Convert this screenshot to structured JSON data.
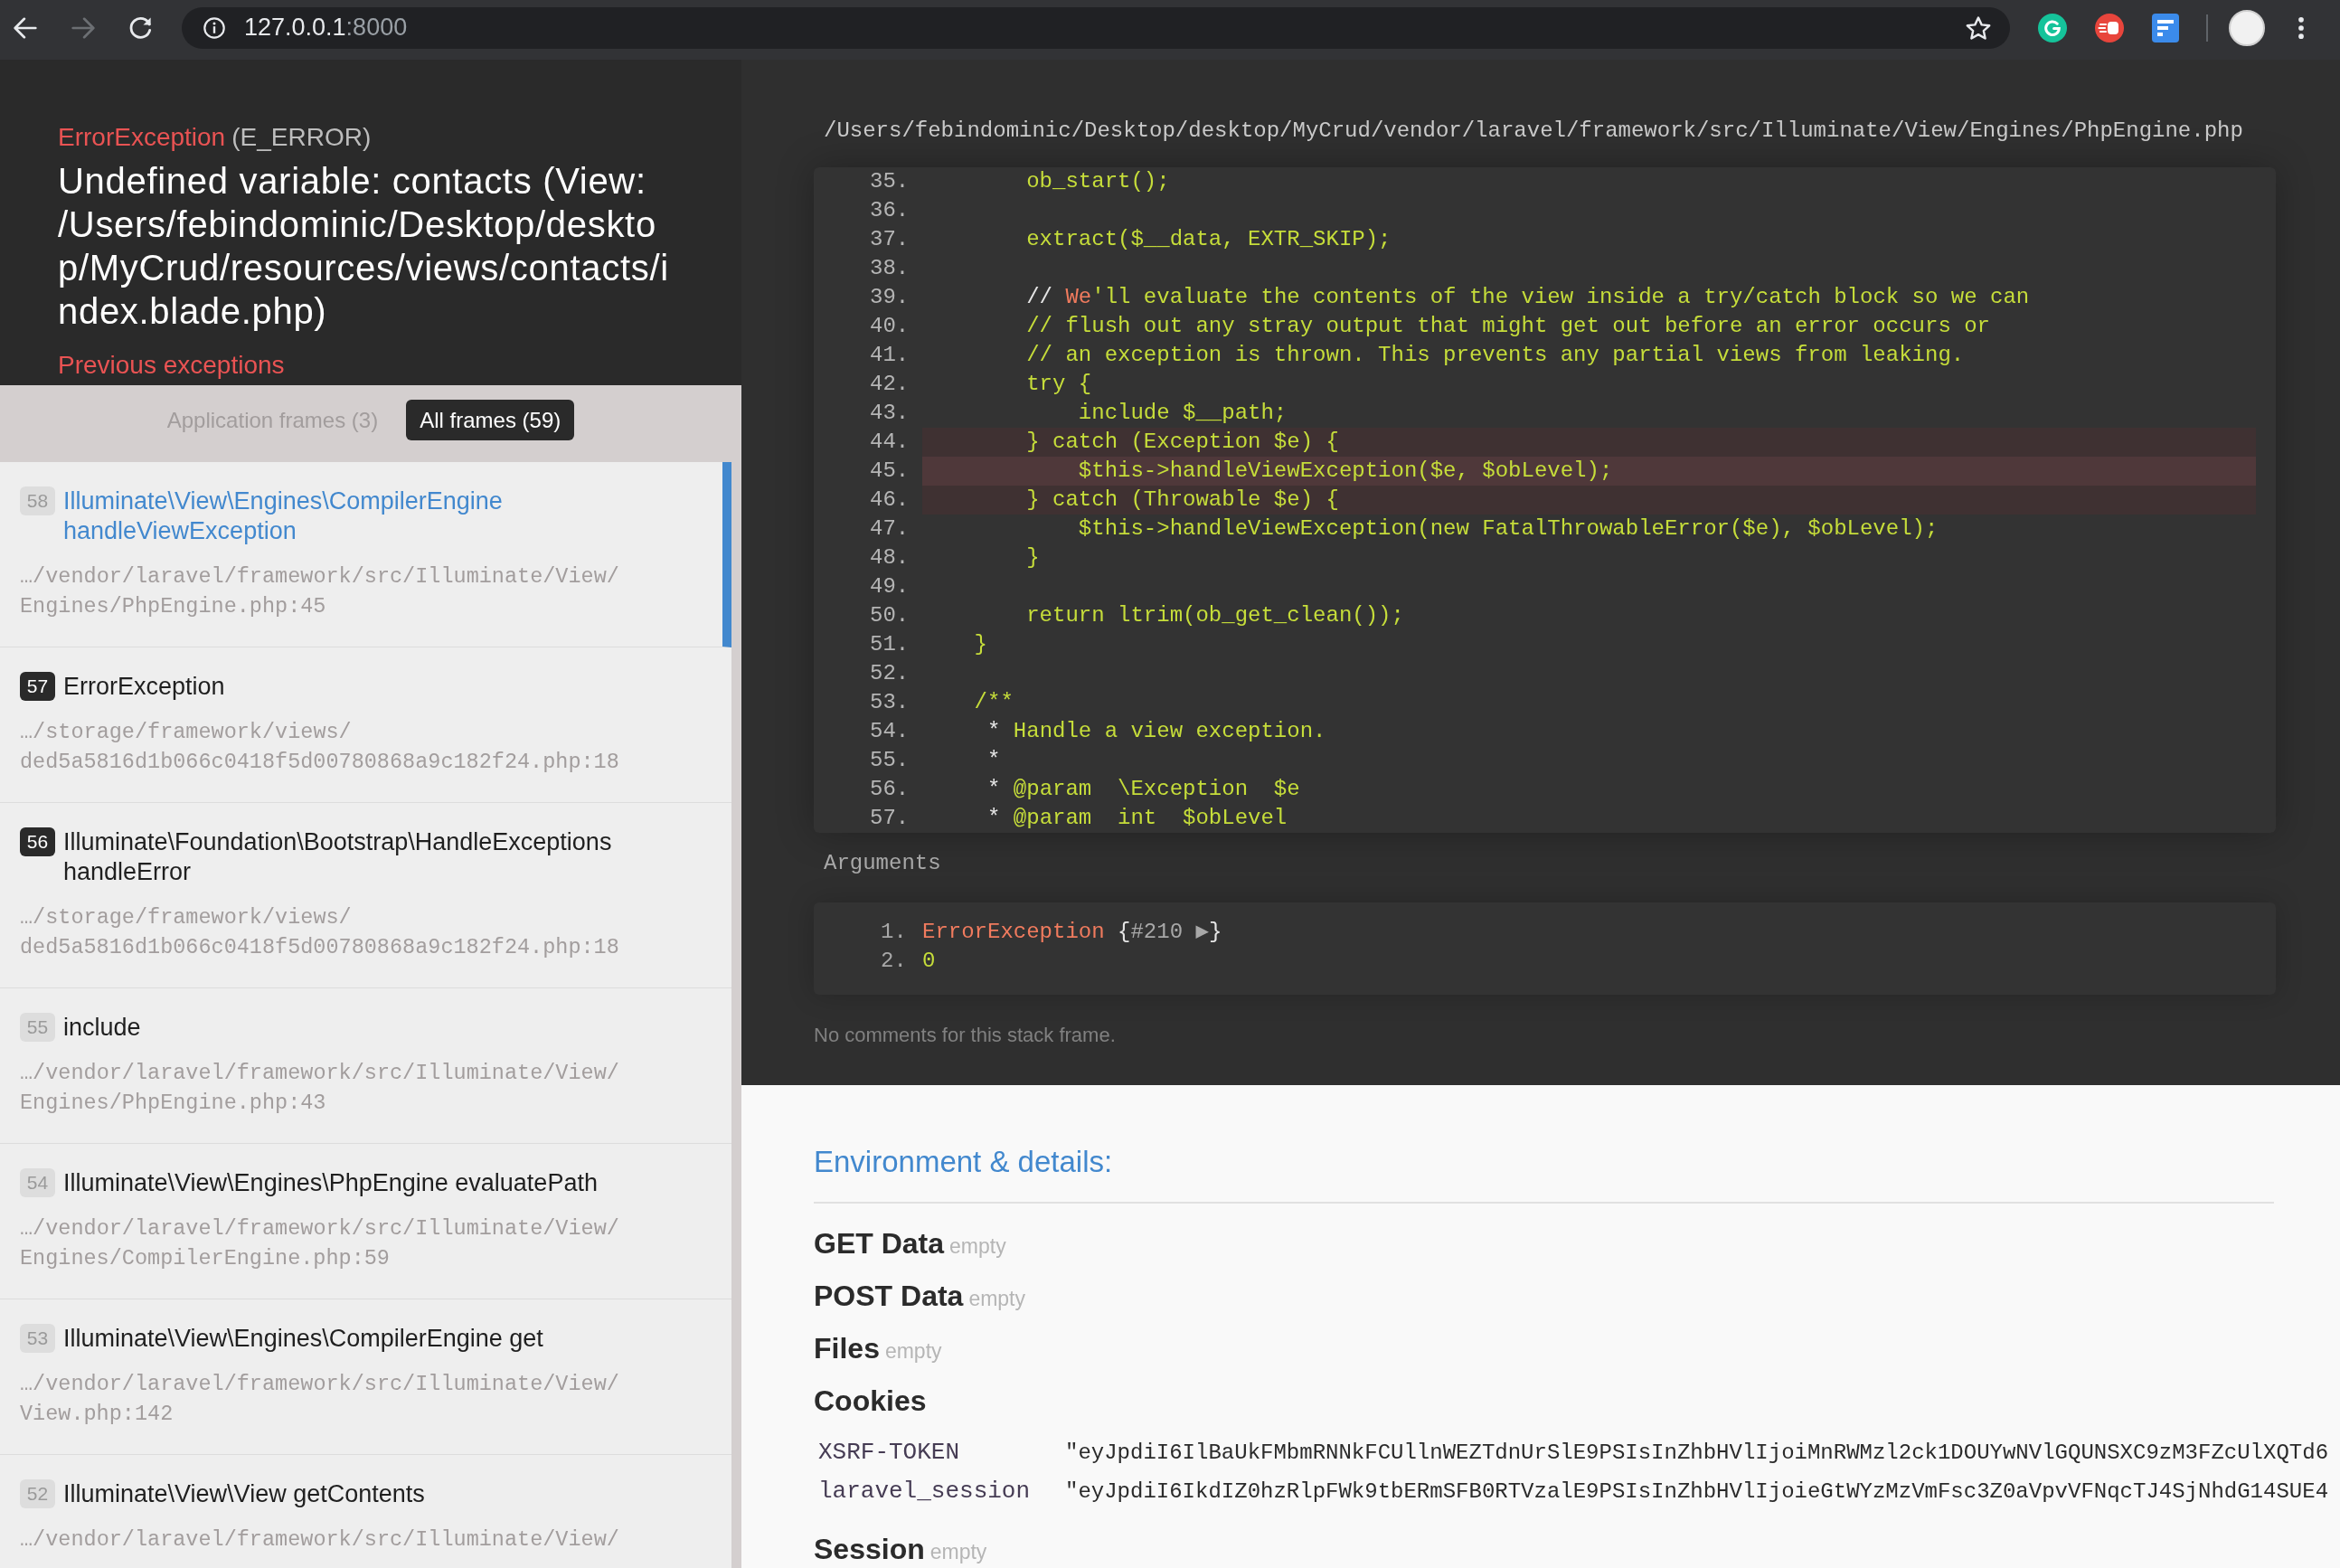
{
  "browser": {
    "nav_buttons": [
      {
        "kind": "back",
        "disabled": false
      },
      {
        "kind": "forward",
        "disabled": true
      },
      {
        "kind": "reload",
        "disabled": false
      }
    ],
    "address": {
      "host": "127.0.0.1",
      "port": ":8000"
    }
  },
  "exception": {
    "type": "ErrorException",
    "code": "(E_ERROR)",
    "message": "Undefined variable: contacts (View: /Users/febindominic/Desktop/desktop/MyCrud/resources/views/contacts/index.blade.php)",
    "previous_link": "Previous exceptions"
  },
  "frame_filters": [
    {
      "label": "Application frames (3)",
      "selected": false
    },
    {
      "label": "All frames (59)",
      "selected": true
    }
  ],
  "frames": [
    {
      "number": "58",
      "title": "Illuminate\\View\\Engines\\CompilerEngine handleViewException",
      "file": "…/vendor/laravel/framework/src/Illuminate/View/Engines/PhpEngine.php:45",
      "application": false,
      "selected": true
    },
    {
      "number": "57",
      "title": "ErrorException",
      "file": "…/storage/framework/views/ded5a5816d1b066c0418f5d00780868a9c182f24.php:18",
      "application": true,
      "selected": false
    },
    {
      "number": "56",
      "title": "Illuminate\\Foundation\\Bootstrap\\HandleExceptions handleError",
      "file": "…/storage/framework/views/ded5a5816d1b066c0418f5d00780868a9c182f24.php:18",
      "application": true,
      "selected": false
    },
    {
      "number": "55",
      "title": "include",
      "file": "…/vendor/laravel/framework/src/Illuminate/View/Engines/PhpEngine.php:43",
      "application": false,
      "selected": false
    },
    {
      "number": "54",
      "title": "Illuminate\\View\\Engines\\PhpEngine evaluatePath",
      "file": "…/vendor/laravel/framework/src/Illuminate/View/Engines/CompilerEngine.php:59",
      "application": false,
      "selected": false
    },
    {
      "number": "53",
      "title": "Illuminate\\View\\Engines\\CompilerEngine get",
      "file": "…/vendor/laravel/framework/src/Illuminate/View/View.php:142",
      "application": false,
      "selected": false
    },
    {
      "number": "52",
      "title": "Illuminate\\View\\View getContents",
      "file": "…/vendor/laravel/framework/src/Illuminate/View/",
      "application": false,
      "selected": false
    }
  ],
  "code_view": {
    "file_path": "/Users/febindominic/Desktop/desktop/MyCrud/vendor/laravel/framework/src/Illuminate/View/Engines/PhpEngine.php",
    "lines": [
      {
        "number": "35.",
        "kind": "plain",
        "tokens": [
          {
            "kind": "code",
            "text": "        ob_start();"
          }
        ]
      },
      {
        "number": "36.",
        "kind": "plain"
      },
      {
        "number": "37.",
        "kind": "plain",
        "tokens": [
          {
            "kind": "code",
            "text": "        extract($__data, EXTR_SKIP);"
          }
        ]
      },
      {
        "number": "38.",
        "kind": "plain"
      },
      {
        "number": "39.",
        "kind": "plain",
        "tokens": [
          {
            "kind": "mark",
            "text": "        // "
          },
          {
            "kind": "accent",
            "text": "We"
          },
          {
            "kind": "code",
            "text": "'ll evaluate the contents of the view inside a try/catch block so we can"
          }
        ]
      },
      {
        "number": "40.",
        "kind": "plain",
        "tokens": [
          {
            "kind": "code",
            "text": "        // flush out any stray output that might get out before an error occurs or"
          }
        ]
      },
      {
        "number": "41.",
        "kind": "plain",
        "tokens": [
          {
            "kind": "code",
            "text": "        // an exception is thrown. This prevents any partial views from leaking."
          }
        ]
      },
      {
        "number": "42.",
        "kind": "plain",
        "tokens": [
          {
            "kind": "code",
            "text": "        try {"
          }
        ]
      },
      {
        "number": "43.",
        "kind": "plain",
        "tokens": [
          {
            "kind": "code",
            "text": "            include $__path;"
          }
        ]
      },
      {
        "number": "44.",
        "kind": "context",
        "tokens": [
          {
            "kind": "code",
            "text": "        } catch (Exception $e) {"
          }
        ]
      },
      {
        "number": "45.",
        "kind": "error",
        "tokens": [
          {
            "kind": "code",
            "text": "            $this->handleViewException($e, $obLevel);"
          }
        ]
      },
      {
        "number": "46.",
        "kind": "context",
        "tokens": [
          {
            "kind": "code",
            "text": "        } catch (Throwable $e) {"
          }
        ]
      },
      {
        "number": "47.",
        "kind": "plain",
        "tokens": [
          {
            "kind": "code",
            "text": "            $this->handleViewException(new FatalThrowableError($e), $obLevel);"
          }
        ]
      },
      {
        "number": "48.",
        "kind": "plain",
        "tokens": [
          {
            "kind": "code",
            "text": "        }"
          }
        ]
      },
      {
        "number": "49.",
        "kind": "plain"
      },
      {
        "number": "50.",
        "kind": "plain",
        "tokens": [
          {
            "kind": "code",
            "text": "        return ltrim(ob_get_clean());"
          }
        ]
      },
      {
        "number": "51.",
        "kind": "plain",
        "tokens": [
          {
            "kind": "code",
            "text": "    }"
          }
        ]
      },
      {
        "number": "52.",
        "kind": "plain"
      },
      {
        "number": "53.",
        "kind": "plain",
        "tokens": [
          {
            "kind": "code",
            "text": "    /**"
          }
        ]
      },
      {
        "number": "54.",
        "kind": "plain",
        "tokens": [
          {
            "kind": "mark",
            "text": "     *"
          },
          {
            "kind": "code",
            "text": " Handle a view exception."
          }
        ]
      },
      {
        "number": "55.",
        "kind": "plain",
        "tokens": [
          {
            "kind": "mark",
            "text": "     *"
          }
        ]
      },
      {
        "number": "56.",
        "kind": "plain",
        "tokens": [
          {
            "kind": "mark",
            "text": "     *"
          },
          {
            "kind": "code",
            "text": " @param  \\Exception  $e"
          }
        ]
      },
      {
        "number": "57.",
        "kind": "plain",
        "tokens": [
          {
            "kind": "mark",
            "text": "     *"
          },
          {
            "kind": "code",
            "text": " @param  int  $obLevel"
          }
        ]
      }
    ]
  },
  "arguments": {
    "label": "Arguments",
    "items": [
      {
        "number": "1.",
        "tokens": [
          {
            "kind": "accent",
            "text": "ErrorException"
          },
          {
            "kind": "mark",
            "text": " {"
          },
          {
            "kind": "muted",
            "text": "#210 ▶"
          },
          {
            "kind": "mark",
            "text": "}"
          }
        ]
      },
      {
        "number": "2.",
        "tokens": [
          {
            "kind": "code",
            "text": "0"
          }
        ]
      }
    ]
  },
  "comments_note": "No comments for this stack frame.",
  "environment": {
    "title": "Environment & details:",
    "sections": [
      {
        "kind": "empty",
        "title": "GET Data",
        "status": "empty"
      },
      {
        "kind": "empty",
        "title": "POST Data",
        "status": "empty"
      },
      {
        "kind": "empty",
        "title": "Files",
        "status": "empty"
      },
      {
        "kind": "table",
        "title": "Cookies",
        "rows": [
          {
            "key": "XSRF-TOKEN",
            "value": "\"eyJpdiI6IlBaUkFMbmRNNkFCUllnWEZTdnUrSlE9PSIsInZhbHVlIjoiMnRWMzl2ck1DOUYwNVlGQUNSXC9zM3FZcUlXQTd6"
          },
          {
            "key": "laravel_session",
            "value": "\"eyJpdiI6IkdIZ0hzRlpFWk9tbERmSFB0RTVzalE9PSIsInZhbHVlIjoieGtWYzMzVmFsc3Z0aVpvVFNqcTJ4SjNhdG14SUE4"
          }
        ]
      },
      {
        "kind": "empty",
        "title": "Session",
        "status": "empty"
      }
    ]
  }
}
